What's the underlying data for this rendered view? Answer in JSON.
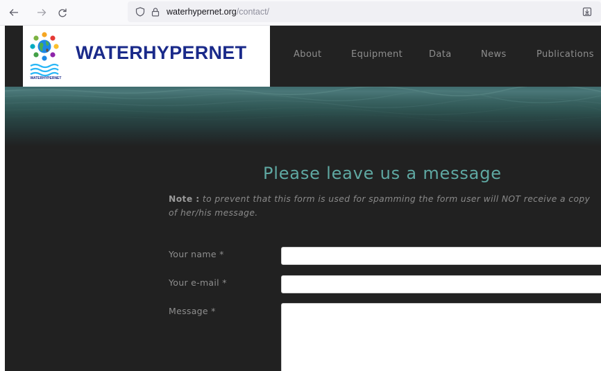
{
  "browser": {
    "url_host": "waterhypernet.org",
    "url_path": "/contact/",
    "icons": {
      "back": "back-arrow-icon",
      "forward": "forward-arrow-icon",
      "reload": "reload-icon",
      "tracking": "tracking-protection-shield-icon",
      "lock": "lock-icon",
      "extension": "download-save-icon"
    }
  },
  "site": {
    "logo_title": "WATERHYPERNET",
    "logo_small_text": "WATERHYPERNET",
    "nav": [
      "About",
      "Equipment",
      "Data",
      "News",
      "Publications"
    ]
  },
  "contact": {
    "heading": "Please leave us a message",
    "note_label": "Note :",
    "note_text": "to prevent that this form is used for spamming the form user will NOT receive a copy of her/his message.",
    "fields": {
      "name_label": "Your name *",
      "name_value": "",
      "email_label": "Your e-mail *",
      "email_value": "",
      "message_label": "Message *",
      "message_value": ""
    }
  },
  "colors": {
    "page_bg": "#212121",
    "accent_heading": "#5fa8a2",
    "logo_blue": "#1a2a8a",
    "nav_text": "#8e8e8e"
  }
}
